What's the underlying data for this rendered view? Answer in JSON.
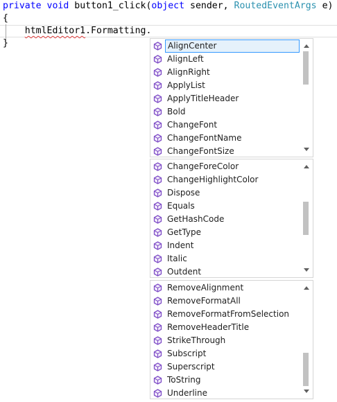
{
  "code": {
    "line1": {
      "kw_private": "private",
      "kw_void": "void",
      "method": "button1_click(",
      "type_object": "object",
      "param1": "sender,",
      "type_args": "RoutedEventArgs",
      "param2": "e)"
    },
    "line2": "{",
    "line3": {
      "indent": "    ",
      "identifier": "htmlEditor1",
      "rest": ".Formatting."
    },
    "line4": "}"
  },
  "icon": "method-cube-icon",
  "colors": {
    "keyword": "#0000ff",
    "type": "#2b91af",
    "icon": "#7f4ec7",
    "selection_border": "#3399ff"
  },
  "lists": [
    {
      "items": [
        "AlignCenter",
        "AlignLeft",
        "AlignRight",
        "ApplyList",
        "ApplyTitleHeader",
        "Bold",
        "ChangeFont",
        "ChangeFontName",
        "ChangeFontSize"
      ],
      "selected_index": 0,
      "scroll_position": 0.0
    },
    {
      "items": [
        "ChangeForeColor",
        "ChangeHighlightColor",
        "Dispose",
        "Equals",
        "GetHashCode",
        "GetType",
        "Indent",
        "Italic",
        "Outdent"
      ],
      "selected_index": -1,
      "scroll_position": 0.5
    },
    {
      "items": [
        "RemoveAlignment",
        "RemoveFormatAll",
        "RemoveFormatFromSelection",
        "RemoveHeaderTitle",
        "StrikeThrough",
        "Subscript",
        "Superscript",
        "ToString",
        "Underline"
      ],
      "selected_index": -1,
      "scroll_position": 1.0
    }
  ]
}
